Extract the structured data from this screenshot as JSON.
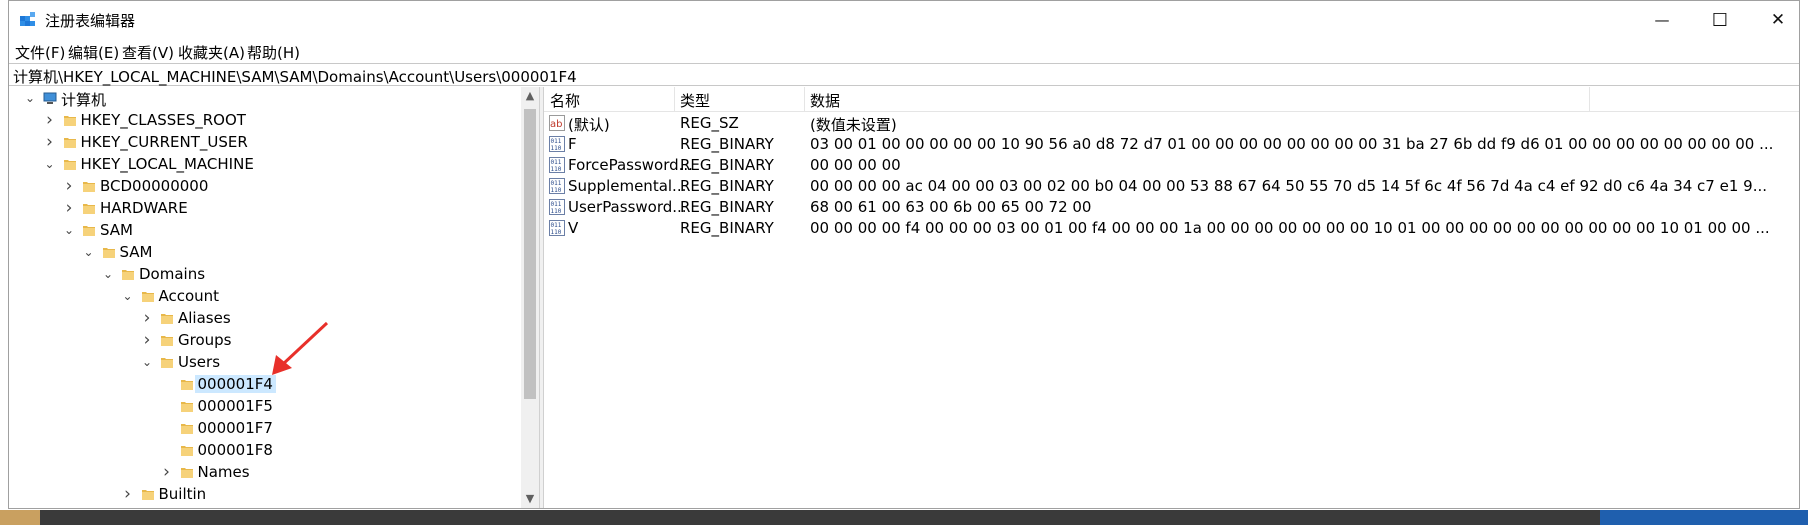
{
  "window": {
    "title": "注册表编辑器"
  },
  "controls": {
    "minimize": "—",
    "maximize": "☐",
    "close": "✕"
  },
  "menu": [
    {
      "label": "文件(F)"
    },
    {
      "label": "编辑(E)"
    },
    {
      "label": "查看(V)"
    },
    {
      "label": "收藏夹(A)"
    },
    {
      "label": "帮助(H)"
    }
  ],
  "address": "计算机\\HKEY_LOCAL_MACHINE\\SAM\\SAM\\Domains\\Account\\Users\\000001F4",
  "tree": [
    {
      "label": "计算机",
      "expander": "v"
    },
    {
      "label": "HKEY_CLASSES_ROOT",
      "expander": ">"
    },
    {
      "label": "HKEY_CURRENT_USER",
      "expander": ">"
    },
    {
      "label": "HKEY_LOCAL_MACHINE",
      "expander": "v"
    },
    {
      "label": "BCD00000000",
      "expander": ">"
    },
    {
      "label": "HARDWARE",
      "expander": ">"
    },
    {
      "label": "SAM",
      "expander": "v"
    },
    {
      "label": "SAM",
      "expander": "v"
    },
    {
      "label": "Domains",
      "expander": "v"
    },
    {
      "label": "Account",
      "expander": "v"
    },
    {
      "label": "Aliases",
      "expander": ">"
    },
    {
      "label": "Groups",
      "expander": ">"
    },
    {
      "label": "Users",
      "expander": "v"
    },
    {
      "label": "000001F4",
      "expander": "",
      "selected": true
    },
    {
      "label": "000001F5",
      "expander": ""
    },
    {
      "label": "000001F7",
      "expander": ""
    },
    {
      "label": "000001F8",
      "expander": ""
    },
    {
      "label": "Names",
      "expander": ">"
    },
    {
      "label": "Builtin",
      "expander": ">"
    }
  ],
  "columns": {
    "name": "名称",
    "type": "类型",
    "data": "数据"
  },
  "values": [
    {
      "name": "(默认)",
      "type": "REG_SZ",
      "data": "(数值未设置)",
      "icon": "string-value-icon"
    },
    {
      "name": "F",
      "type": "REG_BINARY",
      "data": "03 00 01 00 00 00 00 00 10 90 56 a0 d8 72 d7 01 00 00 00 00 00 00 00 00 31 ba 27 6b dd f9 d6 01 00 00 00 00 00 00 00 00 ...",
      "icon": "binary-value-icon"
    },
    {
      "name": "ForcePassword...",
      "type": "REG_BINARY",
      "data": "00 00 00 00",
      "icon": "binary-value-icon"
    },
    {
      "name": "Supplemental...",
      "type": "REG_BINARY",
      "data": "00 00 00 00 ac 04 00 00 03 00 02 00 b0 04 00 00 53 88 67 64 50 55 70 d5 14 5f 6c 4f 56 7d 4a c4 ef 92 d0 c6 4a 34 c7 e1 9...",
      "icon": "binary-value-icon"
    },
    {
      "name": "UserPassword...",
      "type": "REG_BINARY",
      "data": "68 00 61 00 63 00 6b 00 65 00 72 00",
      "icon": "binary-value-icon"
    },
    {
      "name": "V",
      "type": "REG_BINARY",
      "data": "00 00 00 00 f4 00 00 00 03 00 01 00 f4 00 00 00 1a 00 00 00 00 00 00 00 10 01 00 00 00 00 00 00 00 00 00 00 10 01 00 00 ...",
      "icon": "binary-value-icon"
    }
  ],
  "colors": {
    "selection": "#cce8ff",
    "folder": "#e8b84a",
    "annotation_arrow": "#e8302a"
  }
}
